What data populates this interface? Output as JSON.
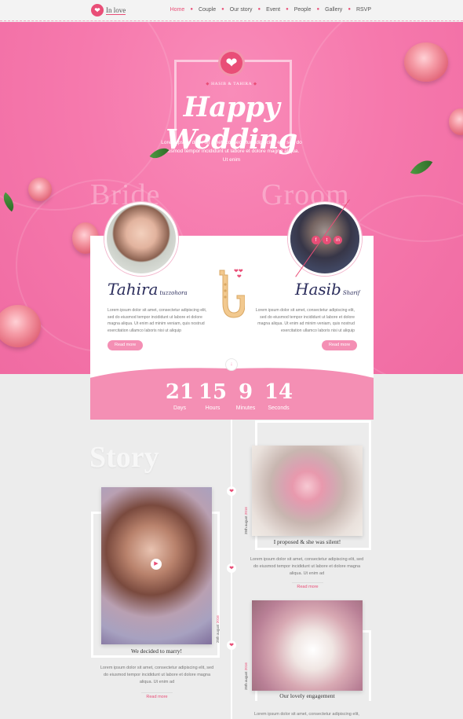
{
  "nav": {
    "logo_text": "In love",
    "items": [
      "Home",
      "Couple",
      "Our story",
      "Event",
      "People",
      "Gallery",
      "RSVP"
    ],
    "active_index": 0
  },
  "hero": {
    "badge": "HASIB & TAHIRA",
    "title": "Happy Wedding",
    "text": "Lorem ipsum dolor sit amet, consectetur adipiscing elit, sed do eiusmod tempor incididunt ut labore et dolore magna aliqua. Ut enim",
    "ghost_left": "Bride",
    "ghost_right": "Groom"
  },
  "bride": {
    "first": "Tahira",
    "last": "tuzzohora",
    "text": "Lorem ipsum dolor sit amet, consectetur adipiscing elit, sed do eiusmod tempor incididunt ut labore et dolore magna aliqua. Ut enim ad minim veniam, quis nostrud exercitation ullamco laboris nisi ut aliquip",
    "button": "Read more"
  },
  "groom": {
    "first": "Hasib",
    "last": "Sharif",
    "text": "Lorem ipsum dolor sit amet, consectetur adipiscing elit, sed do eiusmod tempor incididunt ut labore et dolore magna aliqua. Ut enim ad minim veniam, quis nostrud exercitation ullamco laboris nisi ut aliquip",
    "button": "Read more",
    "socials": [
      "f",
      "t",
      "in"
    ]
  },
  "countdown": [
    {
      "value": "21",
      "label": "Days"
    },
    {
      "value": "15",
      "label": "Hours"
    },
    {
      "value": "9",
      "label": "Minutes"
    },
    {
      "value": "14",
      "label": "Seconds"
    }
  ],
  "story": {
    "heading": "Story",
    "items": [
      {
        "date_a": "25th",
        "date_b": "august",
        "date_c": "2016",
        "caption": "I proposed & she was silent!",
        "text": "Lorem ipsum dolor sit amet, consectetur adipiscing elit, sed do eiusmod tempor incididunt ut labore et dolore magna aliqua. Ut enim ad",
        "link": "Read more"
      },
      {
        "date_a": "25th",
        "date_b": "august",
        "date_c": "2016",
        "caption": "We decided to marry!",
        "text": "Lorem ipsum dolor sit amet, consectetur adipiscing elit, sed do eiusmod tempor incididunt ut labore et dolore magna aliqua. Ut enim ad",
        "link": "Read more"
      },
      {
        "date_a": "25th",
        "date_b": "august",
        "date_c": "2016",
        "caption": "Our lovely engagement",
        "text": "Lorem ipsum dolor sit amet, consectetur adipiscing elit,"
      }
    ]
  },
  "colors": {
    "brand_pink": "#e94e77",
    "hero_pink": "#f679ad",
    "soft_pink": "#f48fb4",
    "navy": "#2b2d5c"
  }
}
